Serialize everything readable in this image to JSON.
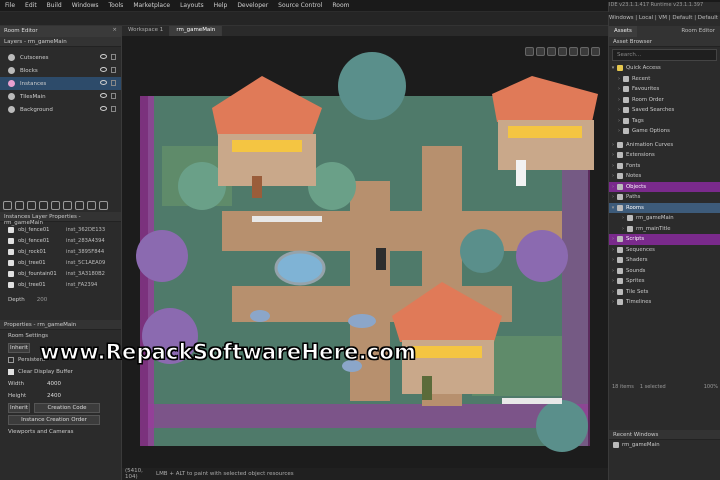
{
  "menu": [
    "File",
    "Edit",
    "Build",
    "Windows",
    "Tools",
    "Marketplace",
    "Layouts",
    "Help",
    "Developer",
    "Source Control",
    "Room"
  ],
  "ide_version": "IDE v23.1.1.417  Runtime v23.1.1.397",
  "workspace_targets": "Windows | Local | VM | Default | Default",
  "room_editor": {
    "title": "Room Editor",
    "layers_header": "Layers - rm_gameMain",
    "layers": [
      {
        "label": "Cutscenes",
        "selected": false
      },
      {
        "label": "Blocks",
        "selected": false
      },
      {
        "label": "Instances",
        "selected": true
      },
      {
        "label": "TilesMain",
        "selected": false
      },
      {
        "label": "Background",
        "selected": false
      }
    ],
    "instances_header": "Instances Layer Properties - rm_gameMain",
    "instances": [
      {
        "name": "obj_fence01",
        "id": "inst_362DE133"
      },
      {
        "name": "obj_fence01",
        "id": "inst_283A4394"
      },
      {
        "name": "obj_rock01",
        "id": "inst_3895F844"
      },
      {
        "name": "obj_tree01",
        "id": "inst_5C1AEA09"
      },
      {
        "name": "obj_fountain01",
        "id": "inst_3A3180B2"
      },
      {
        "name": "obj_tree01",
        "id": "inst_FA2394"
      }
    ],
    "depth_label": "Depth",
    "depth_value": "200",
    "properties_header": "Properties - rm_gameMain",
    "room_settings_label": "Room Settings",
    "inherit_label": "Inherit",
    "persistent_label": "Persistent",
    "clear_display_label": "Clear Display Buffer",
    "width_label": "Width",
    "width_value": "4000",
    "height_label": "Height",
    "height_value": "2400",
    "creation_code_button": "Creation Code",
    "instance_creation_order_button": "Instance Creation Order",
    "viewports_label": "Viewports and Cameras"
  },
  "canvas": {
    "tabs": [
      "Workspace 1",
      "rm_gameMain"
    ],
    "status_coords": "(5410, 104)",
    "status_hint": "LMB + ALT to paint with selected object resources"
  },
  "assets": {
    "tabs": [
      "Assets",
      "Room Editor"
    ],
    "browser_title": "Asset Browser",
    "search_placeholder": "Search...",
    "quick_access": "Quick Access",
    "quick_items": [
      "Recent",
      "Favourites",
      "Room Order",
      "Saved Searches",
      "Tags",
      "Game Options"
    ],
    "groups": [
      "Animation Curves",
      "Extensions",
      "Fonts",
      "Notes",
      "Objects",
      "Paths",
      "Rooms",
      "Scripts",
      "Sequences",
      "Shaders",
      "Sounds",
      "Sprites",
      "Tile Sets",
      "Timelines"
    ],
    "rooms": [
      "rm_gameMain",
      "rm_mainTitle"
    ],
    "footer_items": "18 items",
    "footer_selected": "1 selected",
    "footer_zoom": "100%",
    "recent_windows_title": "Recent Windows",
    "recent_windows_item": "rm_gameMain"
  },
  "watermark": "www.RepackSoftwareHere.com",
  "colors": {
    "purple_highlight": "#7a2a8c",
    "blue_highlight": "#3d5b7a",
    "selection": "#2d4b6a"
  }
}
